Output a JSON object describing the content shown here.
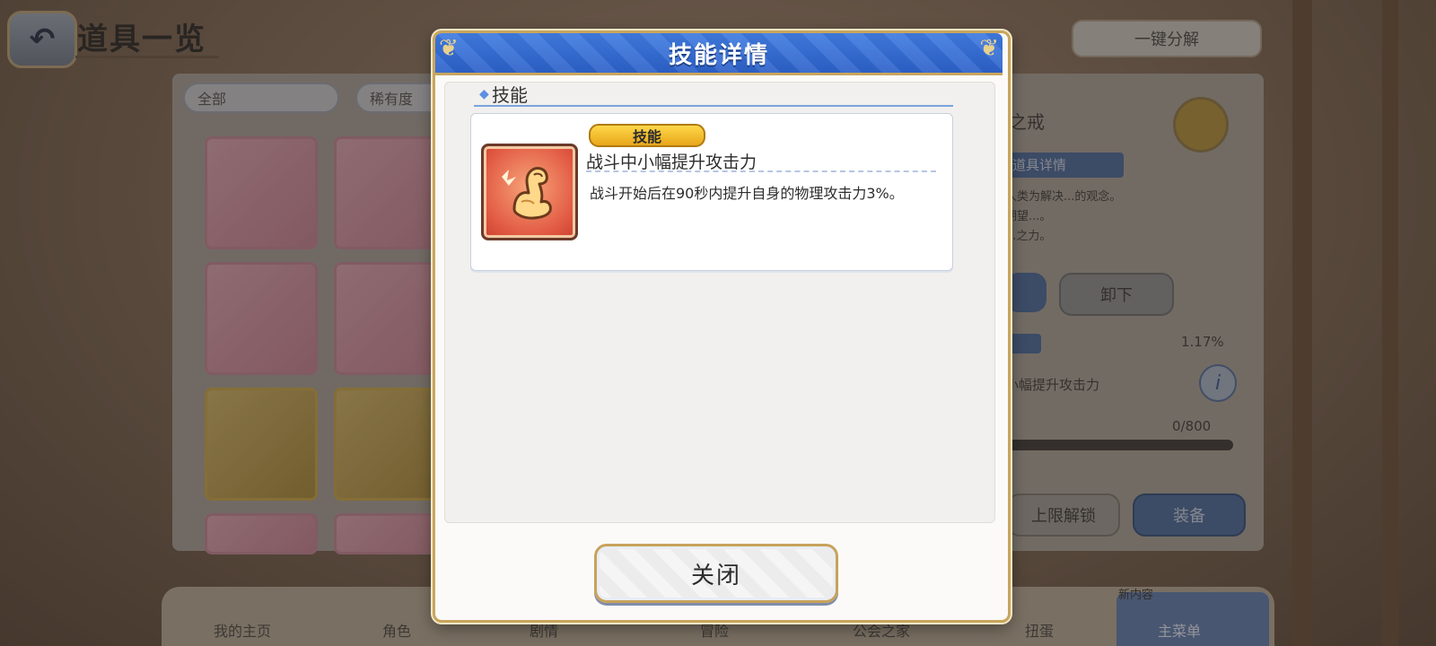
{
  "background": {
    "page_title": "道具一览",
    "decompose_button": "一键分解",
    "filters": [
      "全部",
      "稀有度"
    ],
    "detail_panel": {
      "name_fragment": "之戒",
      "tab_label": "道具详情",
      "desc_lines": [
        "人类为解决...的观念。",
        "期望...。",
        "...之力。"
      ],
      "unequip_button": "卸下",
      "progress_text": "1.17%",
      "skill_text": "小幅提升攻击力",
      "count_text": "0/800",
      "unlock_button": "上限解锁",
      "equip_button": "装备"
    },
    "nav": [
      "我的主页",
      "角色",
      "剧情",
      "冒险",
      "公会之家",
      "扭蛋",
      "主菜单"
    ],
    "nav_new_badge": "新内容"
  },
  "modal": {
    "title": "技能详情",
    "section_label": "技能",
    "skill": {
      "badge": "技能",
      "name": "战斗中小幅提升攻击力",
      "description": "战斗开始后在90秒内提升自身的物理攻击力3%。",
      "icon": "flexed-arm-icon"
    },
    "close_button": "关闭"
  },
  "colors": {
    "header_blue": "#2d61c9",
    "gold_border": "#c9a55e",
    "badge_yellow": "#ffd84a"
  }
}
